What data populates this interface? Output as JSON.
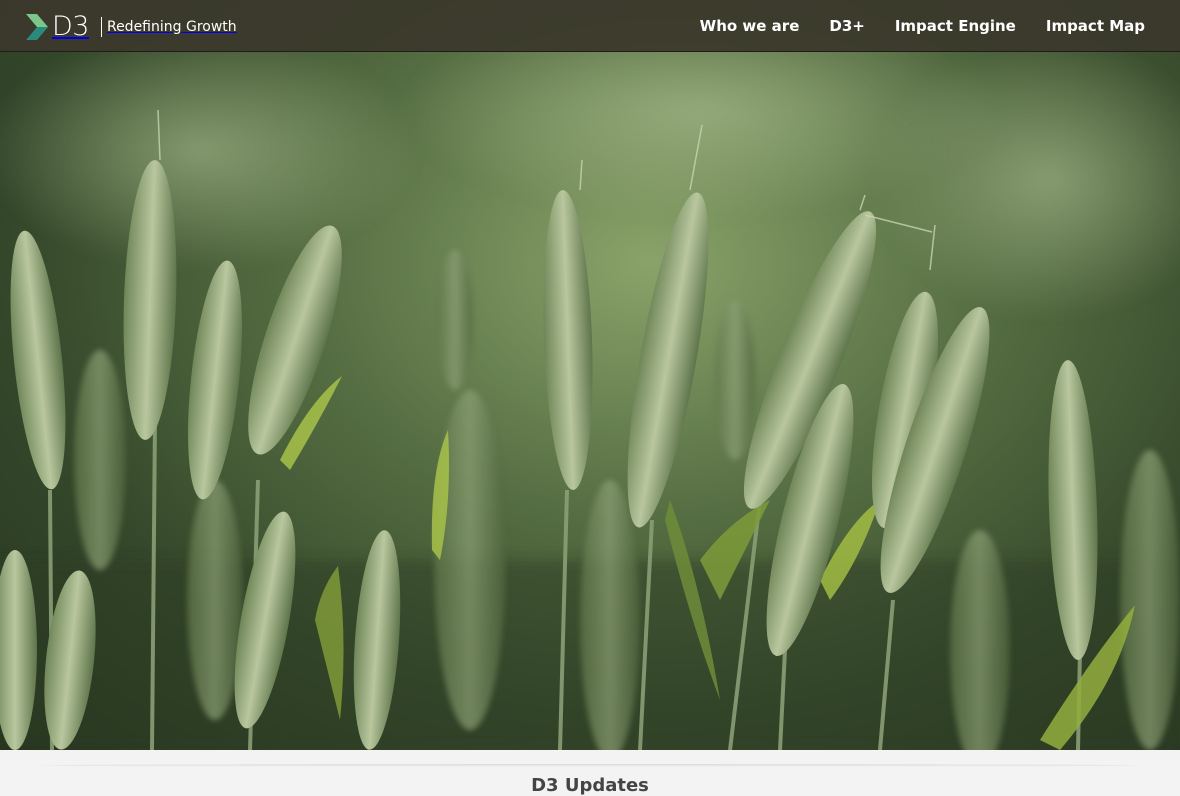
{
  "brand": {
    "logo_text": "D3",
    "tagline": "Redefining Growth",
    "colors": {
      "chevron_light": "#7cc68c",
      "chevron_dark": "#2a8a7c"
    }
  },
  "nav": {
    "items": [
      {
        "label": "Who we are"
      },
      {
        "label": "D3+"
      },
      {
        "label": "Impact Engine"
      },
      {
        "label": "Impact Map"
      }
    ]
  },
  "hero": {
    "image": "wheat-field-photo",
    "colors": {
      "bg_light": "#8aa36a",
      "bg_dark": "#253420",
      "grain": "#a7b98a",
      "stalk": "#7f9468"
    }
  },
  "updates": {
    "title": "D3 Updates"
  }
}
